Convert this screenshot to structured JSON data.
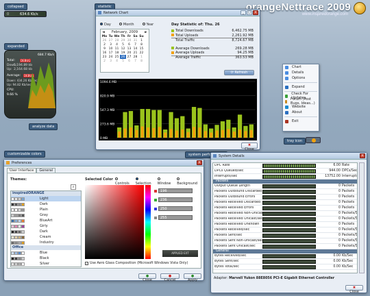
{
  "brand": {
    "title": "orangeNettrace 2009",
    "url": "www.inspiredorange.com"
  },
  "tags": {
    "collapsed": "collapsed",
    "expanded": "expanded",
    "statistic": "statistic",
    "customizable": "customizable colors",
    "system_perf": "system performance",
    "tray": "tray icon"
  },
  "collapsed_bar": {
    "left": "0",
    "right": "634.6 Kb/s"
  },
  "expanded": {
    "total_label": "Total:",
    "total_tag": "DEBUG",
    "down_label": "Down:",
    "down_val": "5,194.89 kb",
    "up_label": "Up:",
    "up_val": "2,164.68 kb",
    "avg_label": "Average:",
    "avg_tag": "DEBUG",
    "avg_down": "Down: 434.26 Kb/sec",
    "avg_up": "Up: 94.82 Kb/sec",
    "cpu_label": "CPU:",
    "cpu_val": "9.66 %",
    "peak": "684.7 Kb/s",
    "peak2": "100",
    "analyze": "analyze data"
  },
  "network_chart": {
    "title": "Network Chart",
    "radio_day": "Day",
    "radio_month": "Month",
    "radio_year": "Year",
    "cal_month": "February, 2009",
    "cal_days": [
      "Mo",
      "Tu",
      "We",
      "Th",
      "Fr",
      "Sa",
      "Su"
    ],
    "cal_rows": [
      [
        "26",
        "27",
        "28",
        "29",
        "30",
        "31",
        "1"
      ],
      [
        "2",
        "3",
        "4",
        "5",
        "6",
        "7",
        "8"
      ],
      [
        "9",
        "10",
        "11",
        "12",
        "13",
        "14",
        "15"
      ],
      [
        "16",
        "17",
        "18",
        "19",
        "20",
        "21",
        "22"
      ],
      [
        "23",
        "24",
        "25",
        "26",
        "27",
        "28",
        "1"
      ],
      [
        "2",
        "3",
        "4",
        "5",
        "6",
        "7",
        "8"
      ]
    ],
    "stat_title": "Day Statistic of: Thu. 26",
    "stats": [
      {
        "label": "Total Downloads",
        "value": "6,462.75 MB",
        "color": "#9ac31c"
      },
      {
        "label": "Total Uploads",
        "value": "2,261.92 MB",
        "color": "#f2a20d"
      },
      {
        "label": "Total Traffic",
        "value": "8,724.67 MB",
        "color": ""
      },
      {
        "label": "Average Downloads",
        "value": "269.28 MB",
        "color": "#9ac31c"
      },
      {
        "label": "Average Uploads",
        "value": "94.25 MB",
        "color": "#f2a20d"
      },
      {
        "label": "Average Traffic",
        "value": "363.53 MB",
        "color": ""
      }
    ],
    "refresh": "Refresh",
    "close": "Close"
  },
  "chart_data": {
    "type": "bar",
    "title": "",
    "ylabels": [
      "1094.6 MB",
      "820.9 MB",
      "547.3 MB",
      "273.6 MB",
      "0 MB"
    ],
    "ylim": [
      0,
      1094.6
    ],
    "series": [
      {
        "name": "Downloads",
        "color": "#9ac31c",
        "values": [
          200,
          500,
          520,
          240,
          560,
          560,
          540,
          540,
          160,
          500,
          380,
          420,
          180,
          600,
          580,
          260,
          180,
          250,
          320,
          350,
          200,
          450,
          230,
          260
        ]
      },
      {
        "name": "Uploads",
        "color": "#f2a20d",
        "values": [
          120,
          180,
          200,
          150,
          220,
          200,
          190,
          210,
          100,
          170,
          140,
          160,
          110,
          210,
          200,
          130,
          100,
          140,
          150,
          170,
          120,
          160,
          130,
          150
        ]
      }
    ]
  },
  "tray_menu": {
    "items": [
      {
        "label": "Chart",
        "icon": "chart-icon"
      },
      {
        "label": "Details",
        "icon": "details-icon"
      },
      {
        "label": "Options",
        "icon": "options-icon"
      },
      {
        "label": "Expand",
        "icon": "expand-icon"
      },
      {
        "label": "Check For Updates",
        "icon": "update-icon"
      },
      {
        "label": "Forum (Post Bugs, Ideas...)",
        "icon": "forum-icon"
      },
      {
        "label": "Website",
        "icon": "website-icon"
      },
      {
        "label": "About",
        "icon": "about-icon"
      },
      {
        "label": "Exit",
        "icon": "exit-icon"
      }
    ]
  },
  "preferences": {
    "title": "Preferences",
    "tabs": [
      "User Interface",
      "General"
    ],
    "themes_label": "Themes:",
    "selected_color": "Selected Color",
    "radios": [
      "Controls",
      "Selection",
      "Window",
      "Background"
    ],
    "groups": [
      {
        "name": "inspiredORANGE",
        "items": [
          "Light",
          "Dark",
          "Plain",
          "Gray",
          "BlueArt",
          "Girly",
          "Dark",
          "Cream",
          "Industry"
        ]
      },
      {
        "name": "Office",
        "items": [
          "Blue",
          "Black",
          "Silver"
        ]
      }
    ],
    "rgb": [
      "196",
      "236",
      "250",
      "255"
    ],
    "apply_preview": "APPLIED EXT",
    "aero": "Use Aero Glass Composition (Microsoft Windows Vista Only)",
    "btn_close": "Close",
    "btn_cancel": "Cancel",
    "btn_apply": "Apply"
  },
  "system_details": {
    "title": "System Details",
    "top_rows": [
      {
        "name": "DPC Rate",
        "value": "6.00",
        "unit": "Rate"
      },
      {
        "name": "DPCs Queued/sec",
        "value": "944.00",
        "unit": "DPCs/Sec"
      },
      {
        "name": "Interrupts/sec",
        "value": "13752.00",
        "unit": "Interrupts/Sec"
      }
    ],
    "cat_packets": "Packets",
    "packet_rows": [
      {
        "name": "Output Queue Length",
        "value": "0",
        "unit": "Packets"
      },
      {
        "name": "Packets Outbound Discarded",
        "value": "0",
        "unit": "Packets"
      },
      {
        "name": "Packets Outbound Errors",
        "value": "0",
        "unit": "Packets"
      },
      {
        "name": "Packets Received Discarded",
        "value": "0",
        "unit": "Packets"
      },
      {
        "name": "Packets Received Errors",
        "value": "0",
        "unit": "Packets"
      },
      {
        "name": "Packets Received Non-Unicast/sec",
        "value": "0",
        "unit": "Packets/Sec"
      },
      {
        "name": "Packets Received Unicast/sec",
        "value": "0",
        "unit": "Packets/Sec"
      },
      {
        "name": "Packets Received Unknown",
        "value": "0",
        "unit": "Packets"
      },
      {
        "name": "Packets Received/sec",
        "value": "0",
        "unit": "Packets/Sec"
      },
      {
        "name": "Packets Sent/sec",
        "value": "0",
        "unit": "Packets/Sec"
      },
      {
        "name": "Packets Sent Non-Unicast/sec",
        "value": "0",
        "unit": "Packets/Sec"
      },
      {
        "name": "Packets Sent Unicast/sec",
        "value": "0",
        "unit": "Packets/Sec"
      }
    ],
    "cat_general": "General",
    "general_rows": [
      {
        "name": "Bytes Received/sec",
        "value": "0.00",
        "unit": "Kb/Sec"
      },
      {
        "name": "Bytes Sent/sec",
        "value": "0.00",
        "unit": "Kb/Sec"
      },
      {
        "name": "Bytes Total/sec",
        "value": "0.00",
        "unit": "Kb/Sec"
      }
    ],
    "adapter_label": "Adapter:",
    "adapter": "Marvell Yukon 88E8056 PCI-E Gigabit Ethernet Controller",
    "close": "Close"
  }
}
